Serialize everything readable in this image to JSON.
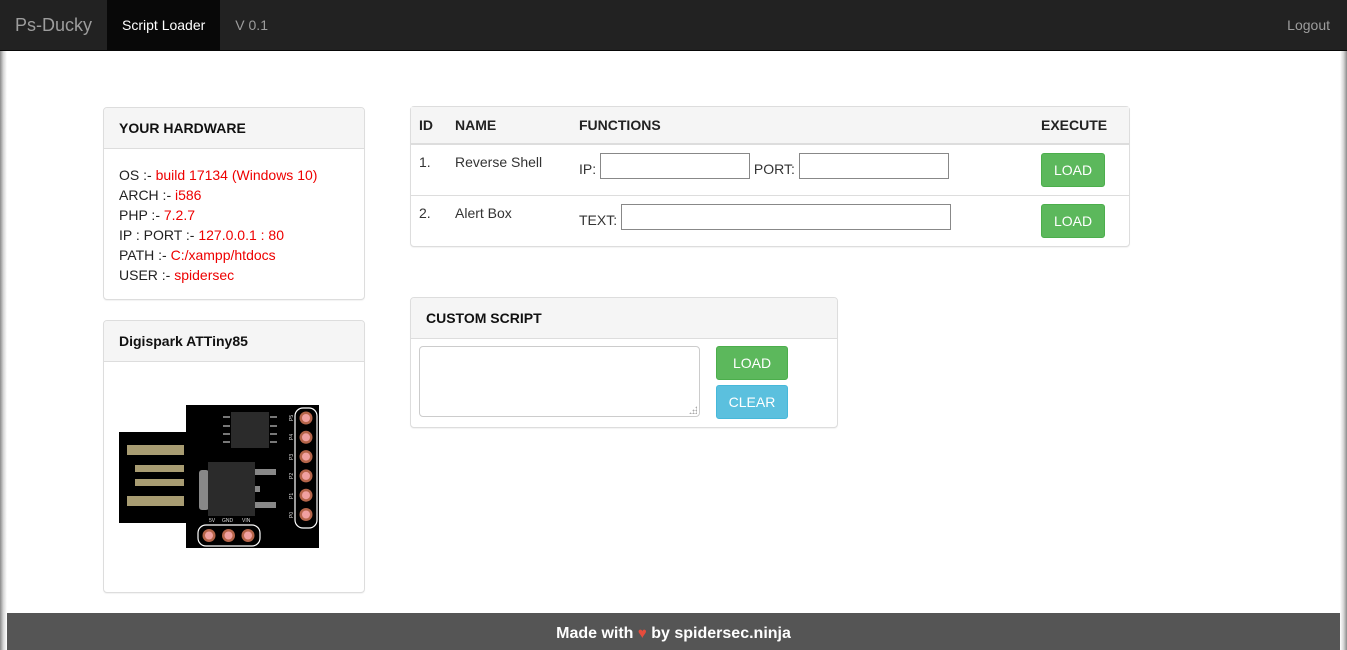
{
  "navbar": {
    "brand": "Ps-Ducky",
    "active_item": "Script Loader",
    "version": "V 0.1",
    "logout": "Logout"
  },
  "hardware": {
    "title": "YOUR HARDWARE",
    "rows": [
      {
        "label": "OS :- ",
        "value": "build 17134 (Windows 10)"
      },
      {
        "label": "ARCH :- ",
        "value": "i586"
      },
      {
        "label": "PHP :- ",
        "value": "7.2.7"
      },
      {
        "label": "IP : PORT :- ",
        "value": "127.0.0.1 : 80"
      },
      {
        "label": "PATH :- ",
        "value": "C:/xampp/htdocs"
      },
      {
        "label": "USER :- ",
        "value": "spidersec"
      }
    ],
    "value_color": "#e00000"
  },
  "device": {
    "title": "Digispark ATTiny85",
    "pin_labels_right": [
      "P5",
      "P4",
      "P3",
      "P2",
      "P1",
      "P0"
    ],
    "pin_labels_bottom": [
      "5V",
      "GND",
      "VIN"
    ]
  },
  "scripts_table": {
    "headers": [
      "ID",
      "NAME",
      "FUNCTIONS",
      "EXECUTE"
    ],
    "rows": [
      {
        "id": "1.",
        "name": "Reverse Shell",
        "fields": [
          {
            "label": "IP:",
            "value": ""
          },
          {
            "label": "PORT:",
            "value": ""
          }
        ],
        "button": "LOAD"
      },
      {
        "id": "2.",
        "name": "Alert Box",
        "fields": [
          {
            "label": "TEXT:",
            "value": ""
          }
        ],
        "button": "LOAD"
      }
    ]
  },
  "custom_script": {
    "title": "CUSTOM SCRIPT",
    "textarea_value": "",
    "load_button": "LOAD",
    "clear_button": "CLEAR"
  },
  "footer": {
    "prefix": "Made with",
    "heart": "♥",
    "suffix": "by spidersec.ninja"
  },
  "colors": {
    "navbar_bg": "#222222",
    "success": "#5cb85c",
    "info": "#5bc0de",
    "footer_bg": "#555555",
    "heart": "#e74c3c"
  }
}
